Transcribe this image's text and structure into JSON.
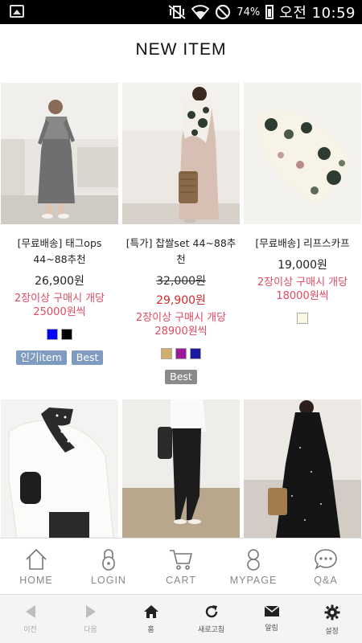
{
  "status_bar": {
    "battery_text": "74%",
    "clock": "오전 10:59"
  },
  "page": {
    "title": "NEW ITEM"
  },
  "products": [
    {
      "name": "[무료배송] 태그ops 44~88추천",
      "price": "26,900원",
      "promo": "2장이상 구매시 개당 25000원씩",
      "swatches": [
        "#0000ff",
        "#000000"
      ],
      "tags": [
        "인기item",
        "Best"
      ]
    },
    {
      "name": "[특가] 찹쌀set 44~88추천",
      "price_original": "32,000원",
      "price": "29,900원",
      "promo": "2장이상 구매시 개당 28900원씩",
      "swatches": [
        "#d2ae6e",
        "#9a1a9a",
        "#1a1aa0"
      ],
      "tags": [
        "Best"
      ]
    },
    {
      "name": "[무료배송] 리프스카프",
      "price": "19,000원",
      "promo": "2장이상 구매시 개당 18000원씩",
      "swatches": [
        "#fbf7e2"
      ],
      "tags": []
    }
  ],
  "bottom_nav": {
    "home": "HOME",
    "login": "LOGIN",
    "cart": "CART",
    "mypage": "MYPAGE",
    "qa": "Q&A"
  },
  "toolbar": {
    "back": "이전",
    "forward": "다음",
    "home": "홈",
    "refresh": "새로고침",
    "notify": "알림",
    "settings": "설정"
  }
}
